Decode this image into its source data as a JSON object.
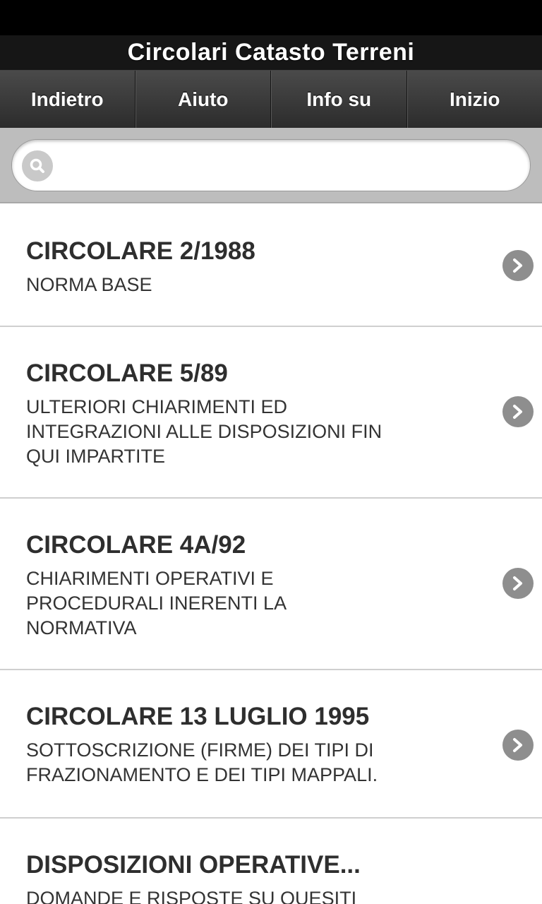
{
  "app": {
    "title": "Circolari Catasto Terreni"
  },
  "nav": {
    "items": [
      {
        "label": "Indietro"
      },
      {
        "label": "Aiuto"
      },
      {
        "label": "Info su"
      },
      {
        "label": "Inizio"
      }
    ]
  },
  "search": {
    "value": "",
    "placeholder": "",
    "icon": "search-icon"
  },
  "list": {
    "items": [
      {
        "title": "CIRCOLARE 2/1988",
        "desc": "NORMA BASE",
        "icon": "chevron-right-icon"
      },
      {
        "title": "CIRCOLARE 5/89",
        "desc": "ULTERIORI CHIARIMENTI ED\nINTEGRAZIONI ALLE DISPOSIZIONI FIN\nQUI IMPARTITE",
        "icon": "chevron-right-icon"
      },
      {
        "title": "CIRCOLARE 4A/92",
        "desc": "CHIARIMENTI OPERATIVI E\nPROCEDURALI INERENTI LA\nNORMATIVA",
        "icon": "chevron-right-icon"
      },
      {
        "title": "CIRCOLARE 13 LUGLIO 1995",
        "desc": "SOTTOSCRIZIONE (FIRME) DEI TIPI DI\nFRAZIONAMENTO E DEI TIPI MAPPALI.",
        "icon": "chevron-right-icon"
      },
      {
        "title": "DISPOSIZIONI OPERATIVE...",
        "desc": "DOMANDE E RISPOSTE SU QUESITI",
        "icon": "chevron-right-icon"
      }
    ]
  },
  "colors": {
    "header_bg": "#161616",
    "nav_bg": "#3a3a3a",
    "search_bar_bg": "#bdbdbd",
    "chevron": "#8e8e8e"
  }
}
